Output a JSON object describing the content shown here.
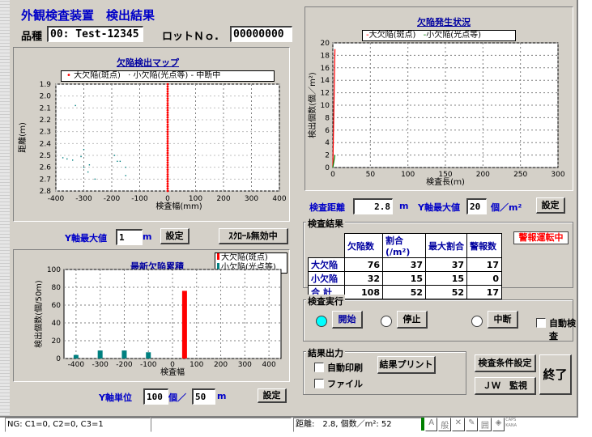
{
  "header": {
    "title": "外観検査装置　検出結果",
    "hinshu_label": "品種",
    "hinshu_value": "00: Test-12345",
    "lot_label": "ロットＮｏ.",
    "lot_value": "00000000"
  },
  "map_chart": {
    "title": "欠陥検出マップ",
    "legend": [
      "大欠陥(斑点)",
      "小欠陥(光点等)",
      "中断中"
    ],
    "ylabel": "距離(ｍ)",
    "xlabel": "検査幅(mm)",
    "yticks": [
      "1.9",
      "2.0",
      "2.1",
      "2.2",
      "2.3",
      "2.4",
      "2.5",
      "2.6",
      "2.7",
      "2.8"
    ],
    "xticks": [
      "-400",
      "-300",
      "-200",
      "-100",
      "0",
      "100",
      "200",
      "300",
      "400"
    ]
  },
  "map_controls": {
    "ymax_label": "Y軸最大値",
    "ymax_value": "1",
    "unit": "m",
    "set_button": "設定",
    "scroll_button": "ｽｸﾛｰﾙ無効中"
  },
  "chart_data": [
    {
      "type": "scatter",
      "title": "欠陥検出マップ",
      "xlabel": "検査幅(mm)",
      "ylabel": "距離(ｍ)",
      "xlim": [
        -400,
        400
      ],
      "ylim": [
        1.9,
        2.8
      ],
      "series": [
        {
          "name": "大欠陥(斑点)",
          "color": "#ff0000",
          "x": [
            0,
            0,
            0,
            0,
            0,
            0,
            0,
            0,
            0,
            0,
            0,
            0,
            0,
            0,
            0,
            0,
            0,
            0,
            0,
            0,
            0,
            0,
            0,
            0,
            0,
            0,
            0,
            0,
            0,
            0,
            0,
            0,
            0,
            0,
            0,
            0,
            0,
            0,
            0,
            0,
            0,
            0,
            0,
            0,
            0,
            0
          ],
          "y": [
            1.9,
            1.92,
            1.94,
            1.96,
            1.98,
            2.0,
            2.02,
            2.04,
            2.06,
            2.08,
            2.1,
            2.12,
            2.14,
            2.16,
            2.18,
            2.2,
            2.22,
            2.24,
            2.26,
            2.28,
            2.3,
            2.32,
            2.34,
            2.36,
            2.38,
            2.4,
            2.42,
            2.44,
            2.46,
            2.48,
            2.5,
            2.52,
            2.54,
            2.56,
            2.58,
            2.6,
            2.62,
            2.64,
            2.66,
            2.68,
            2.7,
            2.72,
            2.74,
            2.76,
            2.78,
            2.8
          ]
        },
        {
          "name": "小欠陥(光点等)",
          "color": "#008080",
          "x": [
            -330,
            -375,
            -360,
            -340,
            -310,
            -300,
            -280,
            -285,
            -260,
            -190,
            -180,
            -170,
            -150,
            -150,
            -300
          ],
          "y": [
            2.08,
            2.52,
            2.53,
            2.54,
            2.51,
            2.6,
            2.58,
            2.64,
            2.7,
            2.5,
            2.55,
            2.55,
            2.67,
            2.6,
            2.45
          ]
        }
      ]
    },
    {
      "type": "bar",
      "title": "最新欠陥累積",
      "xlabel": "検査幅",
      "ylabel": "検出個数(個/50m)",
      "xlim": [
        -450,
        450
      ],
      "ylim": [
        0,
        100
      ],
      "series": [
        {
          "name": "大欠陥(斑点)",
          "color": "#ff0000",
          "x": [
            50
          ],
          "values": [
            76
          ]
        },
        {
          "name": "小欠陥(光点等)",
          "color": "#008080",
          "x": [
            -400,
            -300,
            -200,
            -100
          ],
          "values": [
            4,
            9,
            9,
            7
          ]
        }
      ]
    },
    {
      "type": "line",
      "title": "欠陥発生状況",
      "xlabel": "検査長(ｍ)",
      "ylabel": "検出個数(個／m²)",
      "xlim": [
        0,
        300
      ],
      "ylim": [
        0,
        20
      ],
      "series": [
        {
          "name": "大欠陥(斑点)",
          "color": "#ff0000",
          "x": [
            0,
            2.8
          ],
          "y": [
            0,
            19
          ]
        },
        {
          "name": "小欠陥(光点等)",
          "color": "#008000",
          "x": [
            0,
            2.8
          ],
          "y": [
            0,
            2
          ]
        }
      ]
    }
  ],
  "bar_chart": {
    "title": "最新欠陥累積",
    "legend": [
      "大欠陥(斑点)",
      "小欠陥(光点等)"
    ],
    "ylabel": "検出個数(個/50m)",
    "xlabel": "検査幅",
    "yticks": [
      "0",
      "20",
      "40",
      "60",
      "80",
      "100"
    ],
    "xticks": [
      "-400",
      "-300",
      "-200",
      "-100",
      "0",
      "100",
      "200",
      "300",
      "400"
    ]
  },
  "bar_controls": {
    "unit_label": "Y軸単位",
    "unit_value": "100",
    "unit_text": "個／",
    "per_value": "50",
    "per_unit": "m",
    "set_button": "設定"
  },
  "line_chart": {
    "title": "欠陥発生状況",
    "legend": [
      "大欠陥(斑点)",
      "小欠陥(光点等)"
    ],
    "ylabel": "検出個数(個／m²)",
    "xlabel": "検査長(ｍ)",
    "yticks": [
      "0",
      "2",
      "4",
      "6",
      "8",
      "10",
      "12",
      "14",
      "16",
      "18",
      "20"
    ],
    "xticks": [
      "0",
      "50",
      "100",
      "150",
      "200",
      "250",
      "300"
    ]
  },
  "inspect": {
    "dist_label": "検査距離",
    "dist_value": "2.8",
    "dist_unit": "m",
    "ymax_label": "Y軸最大値",
    "ymax_value": "20",
    "ymax_unit": "個／m²",
    "set_button": "設定"
  },
  "results": {
    "title": "検査結果",
    "headers": [
      "",
      "欠陥数",
      "割合(/m²)",
      "最大割合",
      "警報数"
    ],
    "rows": [
      [
        "大欠陥",
        "76",
        "37",
        "37",
        "17"
      ],
      [
        "小欠陥",
        "32",
        "15",
        "15",
        "0"
      ],
      [
        "合 計",
        "108",
        "52",
        "52",
        "17"
      ]
    ],
    "alarm": "警報運転中"
  },
  "exec": {
    "title": "検査実行",
    "start": "開始",
    "stop": "停止",
    "pause": "中断",
    "auto": "自動検査"
  },
  "output": {
    "title": "結果出力",
    "auto_print": "自動印刷",
    "file": "ファイル",
    "print_button": "結果プリント",
    "cond_button": "検査条件設定",
    "jw_button": "ＪＷ　監視",
    "end_button": "終了"
  },
  "status": {
    "left": "NG: C1=0, C2=0, C3=1",
    "right": "距離:　2.8, 個数／m²: 52",
    "caps": "CAPS",
    "kana": "KANA"
  }
}
